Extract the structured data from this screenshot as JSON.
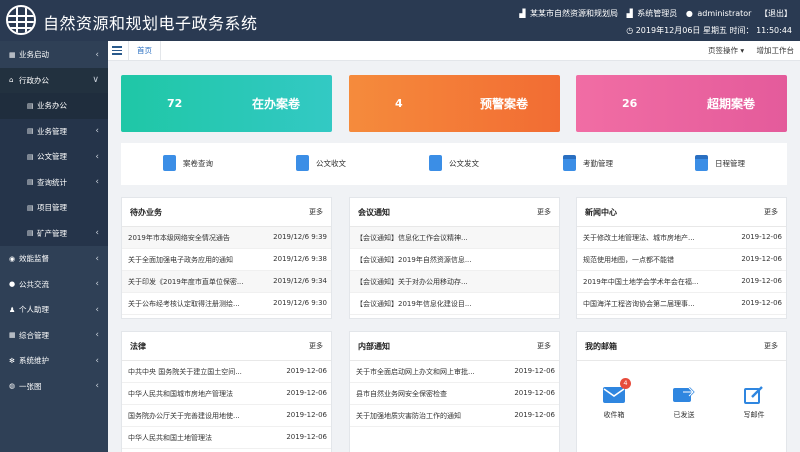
{
  "header": {
    "title": "自然资源和规划电子政务系统",
    "org": "某某市自然资源和规划局",
    "role": "系统管理员",
    "user": "administrator",
    "logout": "【退出】",
    "datetime": "2019年12月06日 星期五 时间：  11:50:44"
  },
  "sidebar": {
    "items": [
      {
        "label": "业务启动",
        "icon": "grid-icon",
        "chevron": "‹"
      },
      {
        "label": "行政办公",
        "icon": "home-icon",
        "chevron": "∨"
      },
      {
        "label": "业务办公",
        "icon": "doc-icon",
        "chevron": ""
      },
      {
        "label": "业务管理",
        "icon": "doc-icon",
        "chevron": "‹"
      },
      {
        "label": "公文管理",
        "icon": "doc-icon",
        "chevron": "‹"
      },
      {
        "label": "查询统计",
        "icon": "doc-icon",
        "chevron": "‹"
      },
      {
        "label": "项目管理",
        "icon": "doc-icon",
        "chevron": ""
      },
      {
        "label": "矿产管理",
        "icon": "doc-icon",
        "chevron": "‹"
      },
      {
        "label": "效能监督",
        "icon": "eye-icon",
        "chevron": "‹"
      },
      {
        "label": "公共交流",
        "icon": "chat-icon",
        "chevron": "‹"
      },
      {
        "label": "个人助理",
        "icon": "user-icon",
        "chevron": "‹"
      },
      {
        "label": "综合管理",
        "icon": "grid-icon",
        "chevron": "‹"
      },
      {
        "label": "系统维护",
        "icon": "gear-icon",
        "chevron": "‹"
      },
      {
        "label": "一张图",
        "icon": "globe-icon",
        "chevron": "‹"
      }
    ]
  },
  "tabbar": {
    "home": "首页",
    "page_ops": "页签操作 ▾",
    "add_workspace": "增加工作台"
  },
  "stats": [
    {
      "num": "72",
      "label": "在办案卷",
      "color": "#22c3b1"
    },
    {
      "num": "4",
      "label": "预警案卷",
      "color": "#f47f3a"
    },
    {
      "num": "26",
      "label": "超期案卷",
      "color": "#ec6ba5"
    }
  ],
  "quick": [
    {
      "label": "案卷查询",
      "icon": "file-search-icon"
    },
    {
      "label": "公文收文",
      "icon": "inbox-doc-icon"
    },
    {
      "label": "公文发文",
      "icon": "send-doc-icon"
    },
    {
      "label": "考勤管理",
      "icon": "calendar-check-icon"
    },
    {
      "label": "日程管理",
      "icon": "calendar-icon"
    }
  ],
  "more": "更多",
  "panels": {
    "todo": {
      "title": "待办业务",
      "rows": [
        {
          "t": "2019年市本级网络安全情况通告",
          "d": "2019/12/6 9:39"
        },
        {
          "t": "关于全面加强电子政务应用的通知",
          "d": "2019/12/6 9:38"
        },
        {
          "t": "关于印发《2019年度市直单位保密...",
          "d": "2019/12/6 9:34"
        },
        {
          "t": "关于公布经考核认定取得注册测绘...",
          "d": "2019/12/6 9:30"
        }
      ]
    },
    "meeting": {
      "title": "会议通知",
      "rows": [
        {
          "t": "【会议通知】信息化工作会议精神...",
          "d": ""
        },
        {
          "t": "【会议通知】2019年自然资源信息...",
          "d": ""
        },
        {
          "t": "【会议通知】关于对办公用移动存...",
          "d": ""
        },
        {
          "t": "【会议通知】2019年信息化建设目...",
          "d": ""
        }
      ]
    },
    "news": {
      "title": "新闻中心",
      "rows": [
        {
          "t": "关于修改土地管理法、城市房地产...",
          "d": "2019-12-06"
        },
        {
          "t": "规范使用地图，一点都不能错",
          "d": "2019-12-06"
        },
        {
          "t": "2019年中国土地学会学术年会在福...",
          "d": "2019-12-06"
        },
        {
          "t": "中国海洋工程咨询协会第二届理事...",
          "d": "2019-12-06"
        }
      ]
    },
    "law": {
      "title": "法律",
      "rows": [
        {
          "t": "中共中央 国务院关于建立国土空间...",
          "d": "2019-12-06"
        },
        {
          "t": "中华人民共和国城市房地产管理法",
          "d": "2019-12-06"
        },
        {
          "t": "国务院办公厅关于完善建设用地使...",
          "d": "2019-12-06"
        },
        {
          "t": "中华人民共和国土地管理法",
          "d": "2019-12-06"
        }
      ]
    },
    "internal": {
      "title": "内部通知",
      "rows": [
        {
          "t": "关于市全面启动网上办文和网上审批...",
          "d": "2019-12-06"
        },
        {
          "t": "县市自然业务网安全保密检查",
          "d": "2019-12-06"
        },
        {
          "t": "关于加强地质灾害防治工作的通知",
          "d": "2019-12-06"
        }
      ]
    },
    "mailbox": {
      "title": "我的邮箱",
      "items": [
        {
          "label": "收件箱",
          "badge": "4",
          "icon": "envelope-icon"
        },
        {
          "label": "已发送",
          "badge": "",
          "icon": "forward-icon"
        },
        {
          "label": "写邮件",
          "badge": "",
          "icon": "edit-icon"
        }
      ]
    }
  }
}
